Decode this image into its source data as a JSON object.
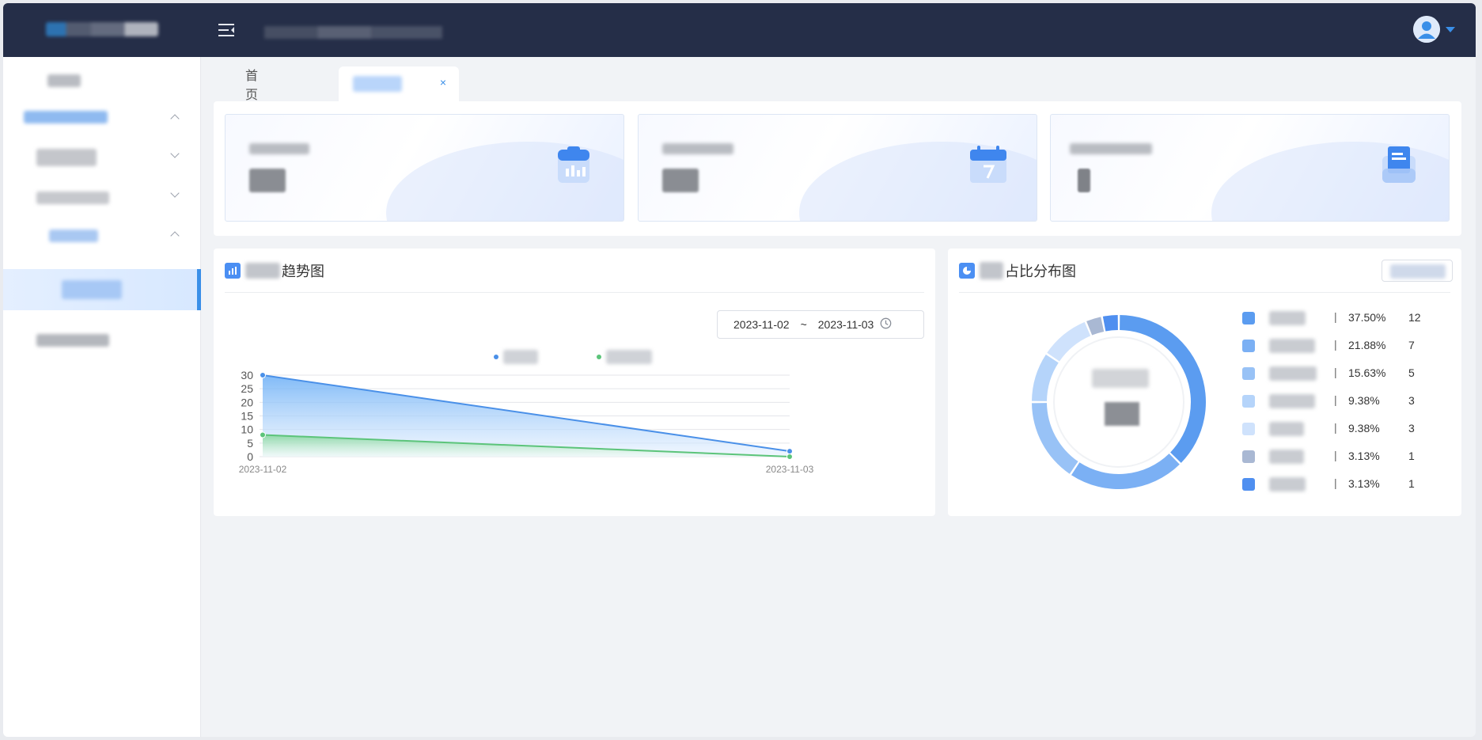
{
  "header": {
    "menu_icon": "menu-fold-icon",
    "avatar_icon": "user-avatar-icon"
  },
  "tabs": [
    {
      "label": "首页"
    },
    {
      "label": "",
      "close": "×"
    }
  ],
  "trend_panel": {
    "title_suffix": "趋势图",
    "date_start": "2023-11-02",
    "date_sep": "~",
    "date_end": "2023-11-03"
  },
  "dist_panel": {
    "title_suffix": "占比分布图"
  },
  "chart_data": [
    {
      "type": "area",
      "x": [
        "2023-11-02",
        "2023-11-03"
      ],
      "ylim": [
        0,
        30
      ],
      "yticks": [
        0,
        5,
        10,
        15,
        20,
        25,
        30
      ],
      "grid": true,
      "legend": "top",
      "series": [
        {
          "values": [
            30,
            2
          ],
          "color": "#4a90e8"
        },
        {
          "values": [
            8,
            0
          ],
          "color": "#5cc47a"
        }
      ]
    },
    {
      "type": "pie",
      "donut": true,
      "slices": [
        {
          "pct": "37.50%",
          "value": 12,
          "color": "#5b9cf0"
        },
        {
          "pct": "21.88%",
          "value": 7,
          "color": "#7bb0f4"
        },
        {
          "pct": "15.63%",
          "value": 5,
          "color": "#98c2f6"
        },
        {
          "pct": "9.38%",
          "value": 3,
          "color": "#b5d4fa"
        },
        {
          "pct": "9.38%",
          "value": 3,
          "color": "#cfe2fc"
        },
        {
          "pct": "3.13%",
          "value": 1,
          "color": "#a9b8d3"
        },
        {
          "pct": "3.13%",
          "value": 1,
          "color": "#4f8ff0"
        }
      ]
    }
  ]
}
